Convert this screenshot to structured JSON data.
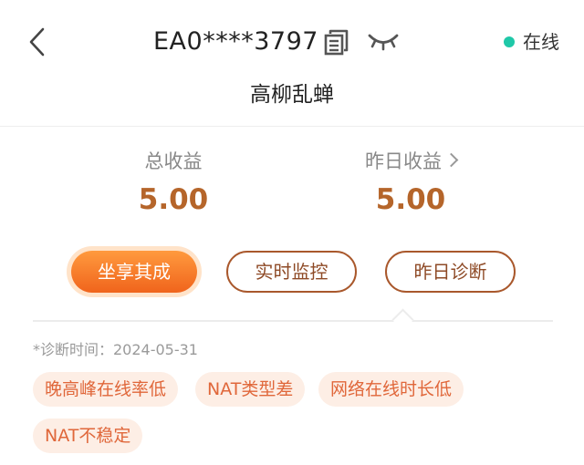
{
  "header": {
    "device_id": "EA0****3797",
    "status": "在线",
    "status_color": "#1fc8a8",
    "device_name": "高柳乱蝉",
    "icons": [
      "chevron-left-icon",
      "copy-icon",
      "eye-closed-icon"
    ]
  },
  "stats": {
    "total_label": "总收益",
    "total_value": "5.00",
    "yesterday_label": "昨日收益",
    "yesterday_value": "5.00"
  },
  "actions": {
    "primary_label": "坐享其成",
    "monitor_label": "实时监控",
    "diagnose_label": "昨日诊断"
  },
  "diagnosis": {
    "time_label": "*诊断时间：2024-05-31",
    "tags": [
      "晚高峰在线率低",
      "NAT类型差",
      "网络在线时长低",
      "NAT不稳定"
    ]
  },
  "colors": {
    "accent": "#f0641c",
    "value_brown": "#b5652a",
    "outline_brown": "#a9582c",
    "tag_text": "#e0673a",
    "tag_bg": "#fdeee5"
  }
}
